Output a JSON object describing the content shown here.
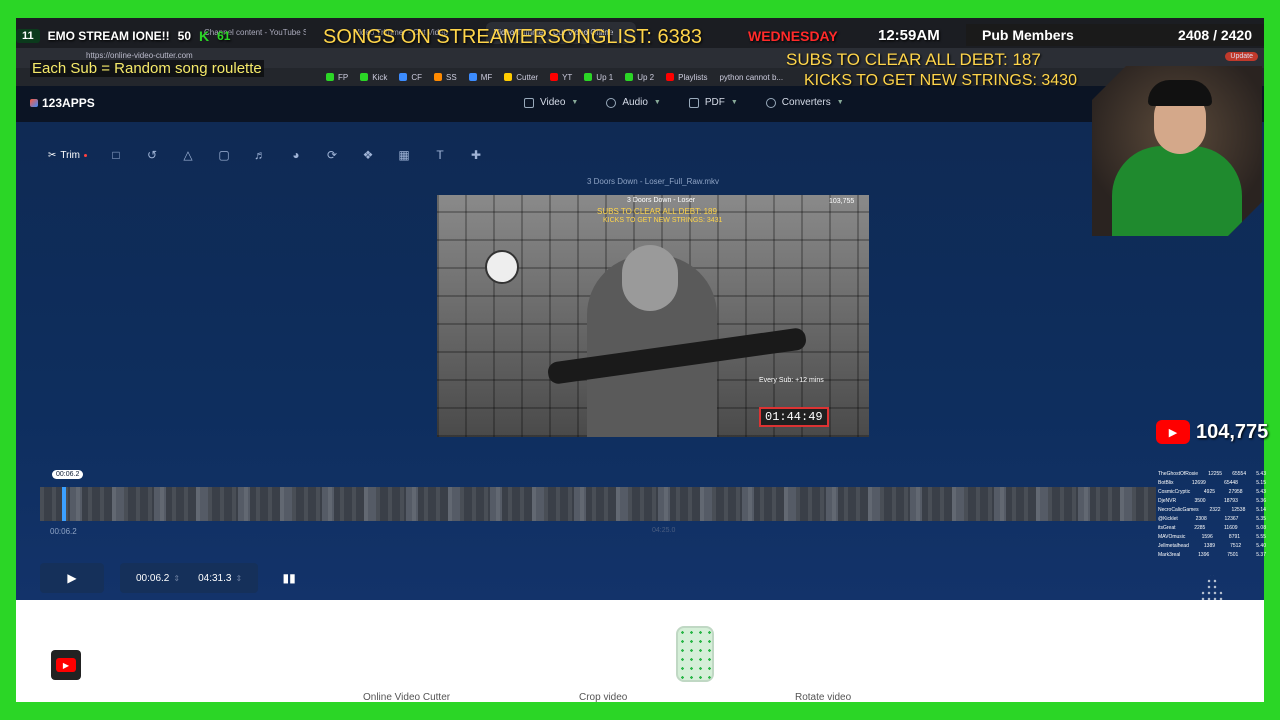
{
  "browser": {
    "tabs": [
      "Channel content - YouTube Studio",
      "Video Trimmer - Cut Video",
      "Video Trimmer - Cut Video Online"
    ],
    "url": "https://online-video-cutter.com",
    "bookmarks": [
      {
        "label": "FP",
        "color": "#2bd626"
      },
      {
        "label": "Kick",
        "color": "#2bd626"
      },
      {
        "label": "CF",
        "color": "#3c8cff"
      },
      {
        "label": "SS",
        "color": "#ff8a00"
      },
      {
        "label": "MF",
        "color": "#3c8cff"
      },
      {
        "label": "Cutter",
        "color": "#ffcc00"
      },
      {
        "label": "YT",
        "color": "#ff0000"
      },
      {
        "label": "Up 1",
        "color": "#2bd626"
      },
      {
        "label": "Up 2",
        "color": "#2bd626"
      },
      {
        "label": "Playlists",
        "color": "#ff0000"
      },
      {
        "label": "python cannot b...",
        "color": "#888888"
      }
    ],
    "update_label": "Update"
  },
  "app": {
    "logo": "123APPS",
    "menu": [
      {
        "label": "Video",
        "icon": "video-icon"
      },
      {
        "label": "Audio",
        "icon": "music-icon"
      },
      {
        "label": "PDF",
        "icon": "file-icon"
      },
      {
        "label": "Converters",
        "icon": "refresh-icon"
      }
    ],
    "tools": {
      "trim_label": "Trim",
      "icons": [
        "crop-icon",
        "rotate-icon",
        "flip-icon",
        "resize-icon",
        "volume-icon",
        "speed-icon",
        "loop-icon",
        "stabilize-icon",
        "image-icon",
        "text-icon",
        "split-icon"
      ]
    },
    "filename": "3 Doors Down - Loser_Full_Raw.mkv",
    "video_overlay": {
      "song": "3 Doors Down - Loser",
      "subs": "SUBS TO CLEAR ALL DEBT: 189",
      "kicks": "KICKS TO GET NEW STRINGS: 3431",
      "views": "103,755",
      "timer": "01:44:49",
      "every_sub": "Every Sub: +12 mins"
    },
    "timeline": {
      "cursor_time": "00:06.2",
      "start_time": "00:06.2",
      "end_time": "04:25.0"
    },
    "controls": {
      "start": "00:06.2",
      "end": "04:31.3"
    },
    "footer_links": [
      "Online Video Cutter",
      "Crop video",
      "Rotate video"
    ]
  },
  "overlay": {
    "rank": "11",
    "stream_title": "EMO STREAM IONE!!",
    "count50": "50",
    "kick_count": "61",
    "songs": "SONGS ON STREAMERSONGLIST: 6383",
    "day": "WEDNESDAY",
    "time": "12:59AM",
    "pub_label": "Pub Members",
    "pub_value": "2408 / 2420",
    "sub_roulette": "Each Sub = Random song roulette",
    "subs_debt": "SUBS TO CLEAR ALL DEBT: 187",
    "kicks_strings": "KICKS TO GET NEW STRINGS: 3430",
    "youtube_count": "104,775",
    "leaderboard": [
      {
        "name": "TheGhostOfRosie",
        "a": "12255",
        "b": "65554",
        "c": "5.43"
      },
      {
        "name": "BotBlix",
        "a": "12699",
        "b": "65448",
        "c": "5.15"
      },
      {
        "name": "CosmicCryptic",
        "a": "4925",
        "b": "27958",
        "c": "5.43"
      },
      {
        "name": "DjeNVR",
        "a": "3500",
        "b": "18793",
        "c": "5.36"
      },
      {
        "name": "NecroCalicGames",
        "a": "2322",
        "b": "12538",
        "c": "5.14"
      },
      {
        "name": "@Kicklet",
        "a": "2308",
        "b": "12367",
        "c": "5.35"
      },
      {
        "name": "itsGreat",
        "a": "2285",
        "b": "11609",
        "c": "5.08"
      },
      {
        "name": "MAVOmusic",
        "a": "1596",
        "b": "8791",
        "c": "5.55"
      },
      {
        "name": "Jellmetalhead",
        "a": "1389",
        "b": "7512",
        "c": "5.40"
      },
      {
        "name": "Mark3real",
        "a": "1396",
        "b": "7501",
        "c": "5.37"
      }
    ],
    "colors": {
      "green_screen": "#2bd626",
      "yellow": "#ffd54a",
      "red": "#ff2a2a"
    }
  }
}
